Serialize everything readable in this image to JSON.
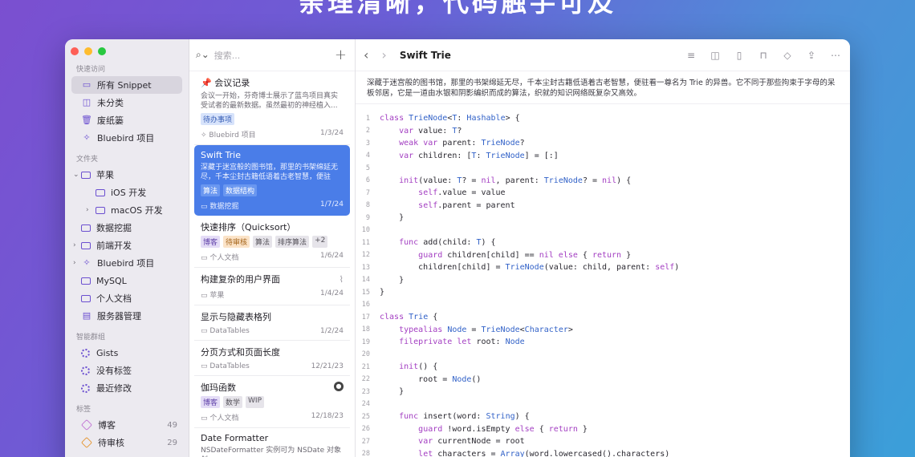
{
  "hero": "亲理清晰，代码触手可及",
  "sidebar": {
    "sec_quick": "快速访问",
    "quick": [
      {
        "label": "所有 Snippet",
        "icon": "inbox-icon"
      },
      {
        "label": "未分类",
        "icon": "unsorted-icon"
      },
      {
        "label": "废纸篓",
        "icon": "trash-icon"
      },
      {
        "label": "Bluebird 项目",
        "icon": "bird-icon"
      }
    ],
    "sec_folders": "文件夹",
    "folders": [
      {
        "label": "苹果"
      },
      {
        "label": "iOS 开发"
      },
      {
        "label": "macOS 开发"
      },
      {
        "label": "数据挖掘"
      },
      {
        "label": "前端开发"
      },
      {
        "label": "Bluebird 项目"
      },
      {
        "label": "MySQL"
      },
      {
        "label": "个人文档"
      },
      {
        "label": "服务器管理"
      }
    ],
    "sec_smart": "智能群组",
    "smart": [
      {
        "label": "Gists"
      },
      {
        "label": "没有标签"
      },
      {
        "label": "最近修改"
      }
    ],
    "sec_tags": "标签",
    "tags": [
      {
        "label": "博客",
        "count": "49",
        "color": "#c47bd6"
      },
      {
        "label": "待审核",
        "count": "29",
        "color": "#e59a3a"
      }
    ]
  },
  "list": {
    "search_placeholder": "搜索...",
    "notes": [
      {
        "title": "会议记录",
        "preview": "会议一开始，芬奇博士展示了蓝鸟项目真实受试者的最新数据。虽然最初的神经植入...",
        "tags": [
          "待办事项"
        ],
        "source": "Bluebird 项目",
        "date": "1/3/24"
      },
      {
        "title": "Swift Trie",
        "preview": "深藏于迷宫般的图书馆，那里的书架绵延无尽，千本尘封古籍低语着古老智慧，便驻看...",
        "tags": [
          "算法",
          "数据结构"
        ],
        "source": "数据挖掘",
        "date": "1/7/24"
      },
      {
        "title": "快速排序（Quicksort）",
        "tags": [
          "博客",
          "待审核",
          "算法",
          "排序算法",
          "+2"
        ],
        "source": "个人文档",
        "date": "1/6/24"
      },
      {
        "title": "构建复杂的用户界面",
        "source": "苹果",
        "date": "1/4/24"
      },
      {
        "title": "显示与隐藏表格列",
        "source": "DataTables",
        "date": "1/2/24"
      },
      {
        "title": "分页方式和页面长度",
        "source": "DataTables",
        "date": "12/21/23"
      },
      {
        "title": "伽玛函数",
        "tags": [
          "博客",
          "数学",
          "WIP"
        ],
        "source": "个人文档",
        "date": "12/18/23"
      },
      {
        "title": "Date Formatter",
        "preview": "NSDateFormatter 实例可为 NSDate 对象创"
      }
    ]
  },
  "editor": {
    "title": "Swift Trie",
    "description": "深藏于迷宫般的图书馆，那里的书架绵延无尽，千本尘封古籍低语着古老智慧，便驻看一尊名为 Trie 的异兽。它不同于那些拘束于字母的呆板邻居，它是一道由水银和阴影编织而成的算法，织就的知识网络既复杂又高效。",
    "code_lines": [
      "class TrieNode<T: Hashable> {",
      "    var value: T?",
      "    weak var parent: TrieNode?",
      "    var children: [T: TrieNode] = [:]",
      "",
      "    init(value: T? = nil, parent: TrieNode? = nil) {",
      "        self.value = value",
      "        self.parent = parent",
      "    }",
      "",
      "    func add(child: T) {",
      "        guard children[child] == nil else { return }",
      "        children[child] = TrieNode(value: child, parent: self)",
      "    }",
      "}",
      "",
      "class Trie {",
      "    typealias Node = TrieNode<Character>",
      "    fileprivate let root: Node",
      "",
      "    init() {",
      "        root = Node()",
      "    }",
      "",
      "    func insert(word: String) {",
      "        guard !word.isEmpty else { return }",
      "        var currentNode = root",
      "        let characters = Array(word.lowercased().characters)"
    ]
  }
}
